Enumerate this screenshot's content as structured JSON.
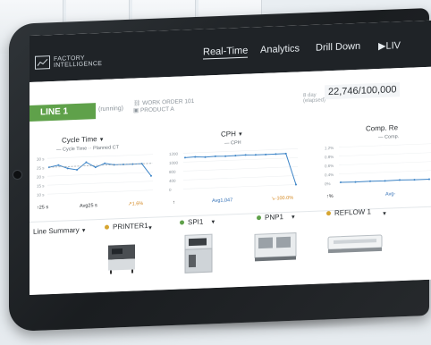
{
  "header": {
    "logo_line1": "FACTORY",
    "logo_line2": "INTELLIGENCE",
    "nav": [
      "Real-Time",
      "Analytics",
      "Drill Down",
      "LIV"
    ],
    "active_tab": "Real-Time"
  },
  "line": {
    "name": "LINE 1",
    "status": "(running)",
    "work_order": "WORK ORDER 101",
    "product": "PRODUCT A",
    "shift_line1": "8 day",
    "shift_line2": "(elapsed)",
    "counter": "22,746/100,000"
  },
  "panels": [
    {
      "title": "Cycle Time",
      "legend_a": "Cycle Time",
      "legend_b": "Planned CT",
      "y_ticks": [
        "30 s",
        "25 s",
        "20 s",
        "15 s",
        "10 s"
      ],
      "stat_left": "25 s",
      "stat_mid_label": "Avg",
      "stat_mid": "25 s",
      "stat_right": "1.6%"
    },
    {
      "title": "CPH",
      "legend_a": "CPH",
      "y_ticks": [
        "1200",
        "1000",
        "800",
        "400",
        "0"
      ],
      "stat_left": "",
      "stat_mid_label": "Avg",
      "stat_mid": "1,047",
      "stat_right": "-100.0%"
    },
    {
      "title": "Comp. Re",
      "legend_a": "Comp.",
      "y_ticks": [
        "1.2%",
        "0.8%",
        "0.6%",
        "0.4%",
        "0%"
      ],
      "stat_left": "%",
      "stat_mid_label": "Avg-",
      "stat_mid": ""
    }
  ],
  "machines": [
    {
      "label": "Line Summary",
      "dot": ""
    },
    {
      "label": "PRINTER1",
      "dot": "#d6a531"
    },
    {
      "label": "SPI1",
      "dot": "#5fa14a"
    },
    {
      "label": "PNP1",
      "dot": "#5fa14a"
    },
    {
      "label": "REFLOW 1",
      "dot": "#d6a531"
    }
  ],
  "chart_data": [
    {
      "type": "line",
      "title": "Cycle Time",
      "series": [
        {
          "name": "Cycle Time",
          "values": [
            25,
            26,
            24,
            23,
            27,
            24,
            26,
            25,
            25,
            25,
            25,
            18
          ]
        },
        {
          "name": "Planned CT",
          "values": [
            25,
            25,
            25,
            25,
            25,
            25,
            25,
            25,
            25,
            25,
            25,
            25
          ]
        }
      ],
      "ylim": [
        10,
        30
      ]
    },
    {
      "type": "line",
      "title": "CPH",
      "series": [
        {
          "name": "CPH",
          "values": [
            1050,
            1060,
            1040,
            1055,
            1045,
            1050,
            1060,
            1050,
            1048,
            1052,
            1055,
            0
          ]
        }
      ],
      "ylim": [
        0,
        1200
      ]
    },
    {
      "type": "line",
      "title": "Comp. Re",
      "series": [
        {
          "name": "Comp.",
          "values": [
            0.02,
            0.01,
            0.02,
            0.01,
            0.02,
            0.01,
            0.01
          ]
        }
      ],
      "ylim": [
        0,
        1.2
      ]
    }
  ]
}
